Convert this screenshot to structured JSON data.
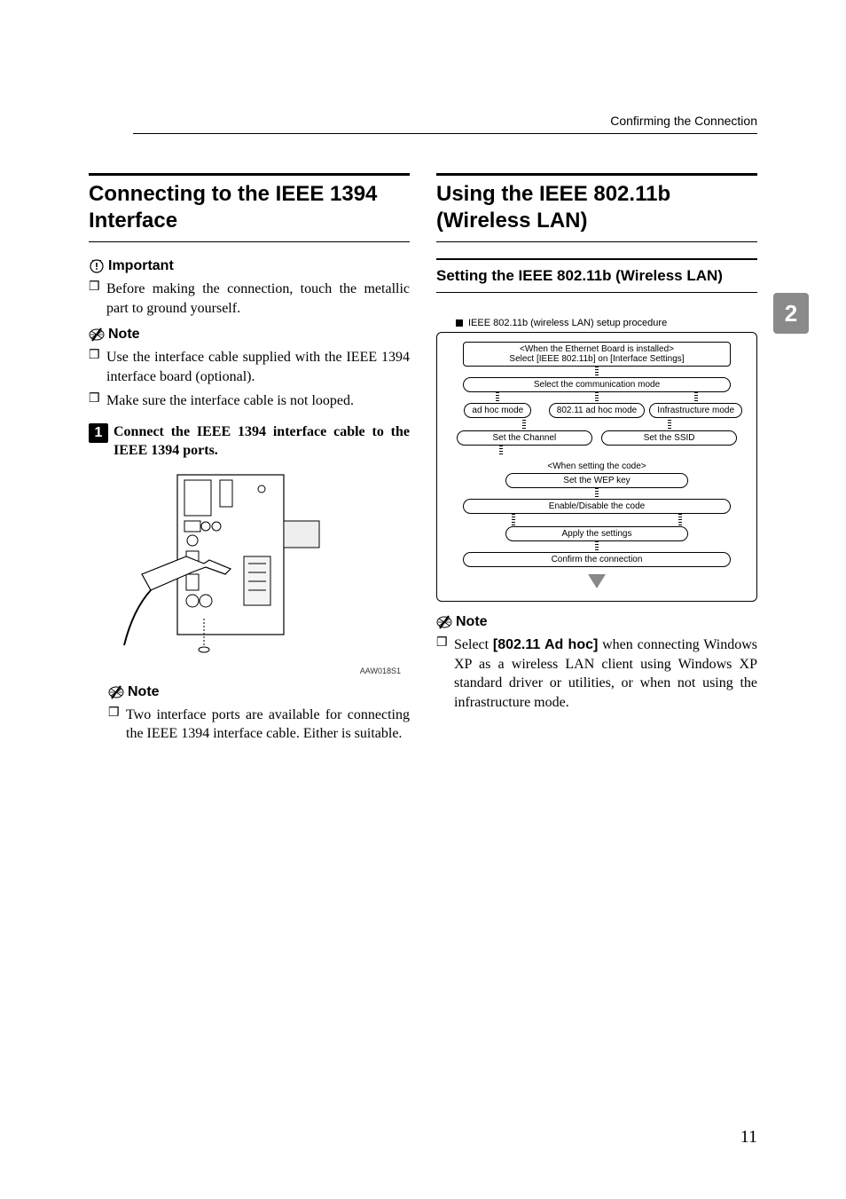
{
  "header": {
    "running": "Confirming the Connection"
  },
  "chapterTab": "2",
  "pageNumber": "11",
  "left": {
    "title": "Connecting to the IEEE 1394 Interface",
    "importantLabel": "Important",
    "important": [
      "Before making the connection, touch the metallic part to ground yourself."
    ],
    "noteLabel": "Note",
    "notes1": [
      "Use the interface cable supplied with the IEEE 1394 interface board (optional).",
      "Make sure the interface cable is not looped."
    ],
    "step1": {
      "num": "1",
      "text": "Connect the IEEE 1394 interface cable to the IEEE 1394 ports."
    },
    "figCaption": "AAW018S1",
    "note2Label": "Note",
    "notes2": [
      "Two interface ports are available for connecting the IEEE 1394 interface cable. Either is suitable."
    ]
  },
  "right": {
    "title": "Using the IEEE 802.11b (Wireless LAN)",
    "subsection": "Setting the IEEE 802.11b (Wireless LAN)",
    "diagram": {
      "heading": "IEEE 802.11b (wireless LAN) setup procedure",
      "box1line1": "<When the Ethernet Board is installed>",
      "box1line2": "Select [IEEE 802.11b] on [Interface Settings]",
      "commMode": "Select the communication mode",
      "modes": [
        "ad hoc mode",
        "802.11 ad hoc mode",
        "Infrastructure mode"
      ],
      "setChannel": "Set the Channel",
      "setSSID": "Set the SSID",
      "whenCode": "<When setting the code>",
      "setWEP": "Set the WEP key",
      "enableDisable": "Enable/Disable the code",
      "apply": "Apply the settings",
      "confirm": "Confirm the connection"
    },
    "noteLabel": "Note",
    "noteText": {
      "pre": "Select ",
      "bold": "[802.11 Ad hoc]",
      "post": " when connecting Windows XP as a wireless LAN client using Windows XP standard driver or utilities, or when not using the infrastructure mode."
    }
  }
}
